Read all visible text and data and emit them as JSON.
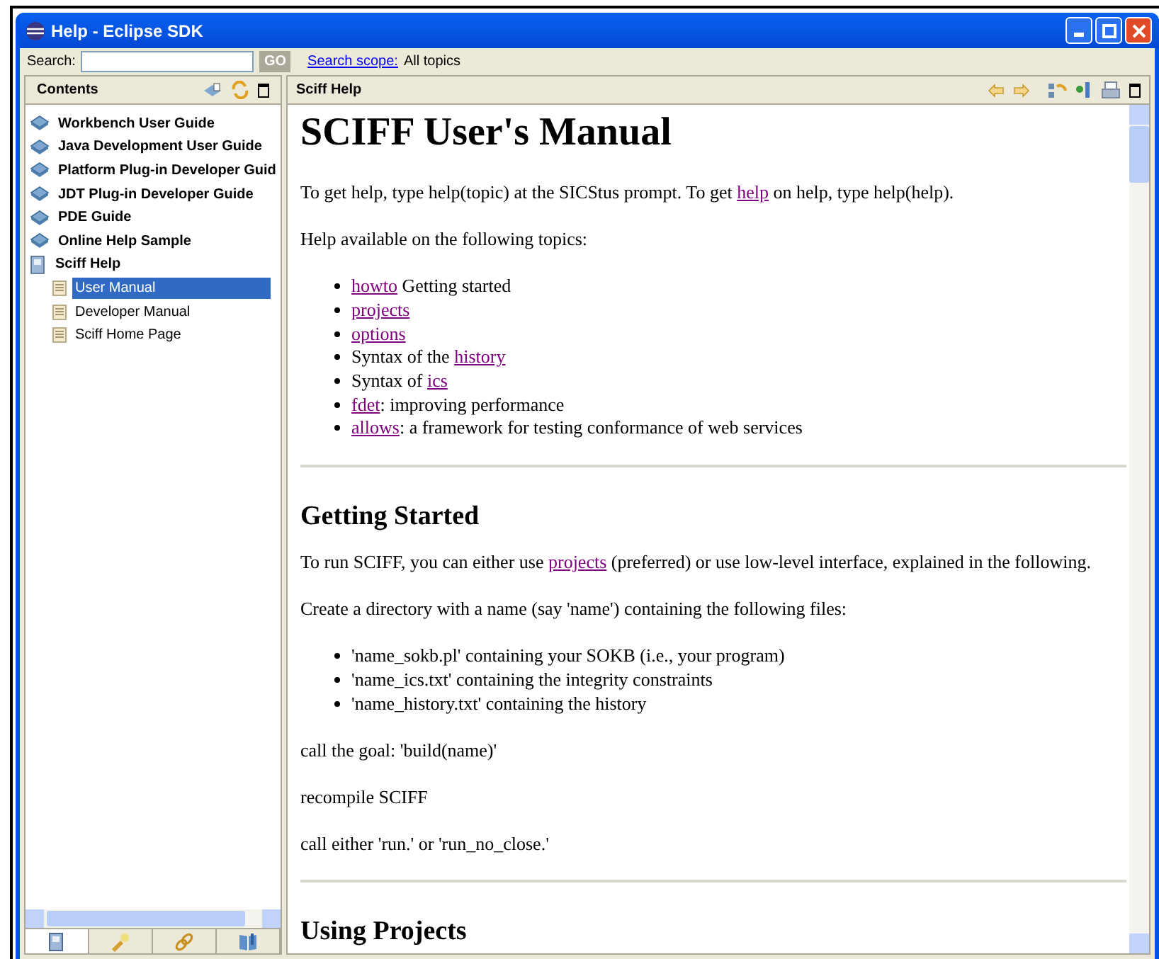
{
  "window": {
    "title": "Help - Eclipse SDK"
  },
  "search": {
    "label": "Search:",
    "go": "GO",
    "scope_link": "Search scope:",
    "scope_value": "All topics"
  },
  "contents": {
    "title": "Contents",
    "tree": [
      {
        "label": "Workbench User Guide",
        "kind": "book",
        "selected": false
      },
      {
        "label": "Java Development User Guide",
        "kind": "book",
        "selected": false
      },
      {
        "label": "Platform Plug-in Developer Guid",
        "kind": "book",
        "selected": false
      },
      {
        "label": "JDT Plug-in Developer Guide",
        "kind": "book",
        "selected": false
      },
      {
        "label": "PDE Guide",
        "kind": "book",
        "selected": false
      },
      {
        "label": "Online Help Sample",
        "kind": "book",
        "selected": false
      },
      {
        "label": "Sciff Help",
        "kind": "folder",
        "selected": false,
        "children": [
          {
            "label": "User Manual",
            "kind": "page",
            "selected": true
          },
          {
            "label": "Developer Manual",
            "kind": "page",
            "selected": false
          },
          {
            "label": "Sciff Home Page",
            "kind": "page",
            "selected": false
          }
        ]
      }
    ],
    "tabs": [
      {
        "kind": "contents",
        "selected": true
      },
      {
        "kind": "search",
        "selected": false
      },
      {
        "kind": "links",
        "selected": false
      },
      {
        "kind": "bookmarks",
        "selected": false
      }
    ]
  },
  "document": {
    "title": "Sciff Help",
    "blocks": [
      {
        "kind": "h1",
        "text": "SCIFF User's Manual"
      },
      {
        "kind": "p",
        "parts": [
          {
            "text": "To get help, type help(topic) at the SICStus prompt. To get ",
            "link": false
          },
          {
            "text": "help",
            "link": true
          },
          {
            "text": " on help, type help(help).",
            "link": false
          }
        ]
      },
      {
        "kind": "p",
        "parts": [
          {
            "text": "Help available on the following topics:",
            "link": false
          }
        ]
      },
      {
        "kind": "ul",
        "items": [
          [
            {
              "text": "howto",
              "link": true
            },
            {
              "text": " Getting started",
              "link": false
            }
          ],
          [
            {
              "text": "projects",
              "link": true
            }
          ],
          [
            {
              "text": "options",
              "link": true
            }
          ],
          [
            {
              "text": "Syntax of the ",
              "link": false
            },
            {
              "text": "history",
              "link": true
            }
          ],
          [
            {
              "text": "Syntax of ",
              "link": false
            },
            {
              "text": "ics",
              "link": true
            }
          ],
          [
            {
              "text": "fdet",
              "link": true
            },
            {
              "text": ": improving performance",
              "link": false
            }
          ],
          [
            {
              "text": "allows",
              "link": true
            },
            {
              "text": ": a framework for testing conformance of web services",
              "link": false
            }
          ]
        ]
      },
      {
        "kind": "hr"
      },
      {
        "kind": "h2",
        "text": "Getting Started"
      },
      {
        "kind": "p",
        "parts": [
          {
            "text": "To run SCIFF, you can either use ",
            "link": false
          },
          {
            "text": "projects",
            "link": true
          },
          {
            "text": " (preferred) or use low-level interface, explained in the following.",
            "link": false
          }
        ]
      },
      {
        "kind": "p",
        "parts": [
          {
            "text": "Create a directory with a name (say 'name') containing the following files:",
            "link": false
          }
        ]
      },
      {
        "kind": "ul",
        "items": [
          [
            {
              "text": "'name_sokb.pl' containing your SOKB (i.e., your program)",
              "link": false
            }
          ],
          [
            {
              "text": "'name_ics.txt' containing the integrity constraints",
              "link": false
            }
          ],
          [
            {
              "text": "'name_history.txt' containing the history",
              "link": false
            }
          ]
        ]
      },
      {
        "kind": "p",
        "parts": [
          {
            "text": "call the goal: 'build(name)'",
            "link": false
          }
        ]
      },
      {
        "kind": "p",
        "parts": [
          {
            "text": "recompile SCIFF",
            "link": false
          }
        ]
      },
      {
        "kind": "p",
        "parts": [
          {
            "text": "call either 'run.' or 'run_no_close.'",
            "link": false
          }
        ]
      },
      {
        "kind": "hr"
      },
      {
        "kind": "h2",
        "text": "Using Projects"
      }
    ]
  }
}
